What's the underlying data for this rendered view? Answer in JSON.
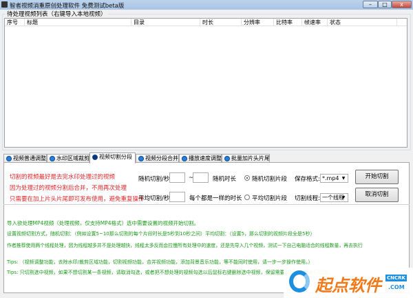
{
  "window": {
    "title": "智者视频消重原创处理软件 免费测试beta版",
    "minimize": "–",
    "maximize": "□",
    "close": "x"
  },
  "list_group": {
    "title": "待处理视频列表（右键导入本地视频）",
    "columns": [
      "序号",
      "标题",
      "目录",
      "时长",
      "分辨率",
      "比特率",
      "帧速率",
      "状态"
    ]
  },
  "tabs": [
    {
      "label": "视频普通调整"
    },
    {
      "label": "水印区域裁剪"
    },
    {
      "label": "视频切割分段"
    },
    {
      "label": "视频分段合并"
    },
    {
      "label": "播放速度调整"
    },
    {
      "label": "批量加片头片尾"
    }
  ],
  "active_tab": 2,
  "panel": {
    "notes": [
      "切割的视频最好是去完水印处理过的视频",
      "因为处理过的视频分割后合并，不用再次处理",
      "只需要在加上片头片尾即可发布使用，避免重复操作"
    ],
    "random_label": "随机切割/秒:",
    "random_from": "",
    "tilde": "~",
    "random_to": "",
    "random_desc": "随机时长",
    "radio_random": "随机切割片段",
    "radio_random_checked": true,
    "avg_label": "平均切割/秒:",
    "avg_value": "",
    "avg_desc": "每个都是一样的时长",
    "radio_avg": "平均切割片段",
    "radio_avg_checked": false,
    "format_label": "保存格式:",
    "format_value": "*.mp4",
    "thread_label": "切割线程:",
    "thread_value": "一个线程",
    "start_button": "开始切割",
    "cancel_button": "取消切割"
  },
  "instructions": [
    "导入欲处理MP4视频（处理视频，仅支持MP4格式）选中需要设置的视频开始切割。",
    "设置视频切割方式，随机切割：（例如设置5~10那么切割的每个片段时长是5秒到10秒之间）平均切割：（设置5，那么切割的视频片段全是5秒）",
    "作者推荐使用两个线程处理，因为线程越多并不是处理越快，线程太多反而会拉慢所有处理中的速度，还是先导入几个视频，测试一下自己电脑适合的线程数量，再去执行"
  ],
  "tips": [
    "Tips:  （视频调整功能，去除水印/裁剪区域功能，切割视频功能，合并视频功能，添加背景音乐功能，等不能同时使用，请一步一步操作使用。）",
    "Tips:  只切割选中视频，如果不想切割某一条视频，请取消勾选，或者把不想处理的视频勾选以后鼠标右键删除选中视频，保留需要处理的视频进行切割。"
  ],
  "watermark": {
    "text": "起点软件",
    "sub": "CNCRK",
    ".com": ".COM"
  },
  "colors": {
    "red_note": "#e0262a",
    "green_text": "#1a9a1a",
    "watermark_orange": "#f07a1a",
    "watermark_blue": "#1e8fe0"
  }
}
